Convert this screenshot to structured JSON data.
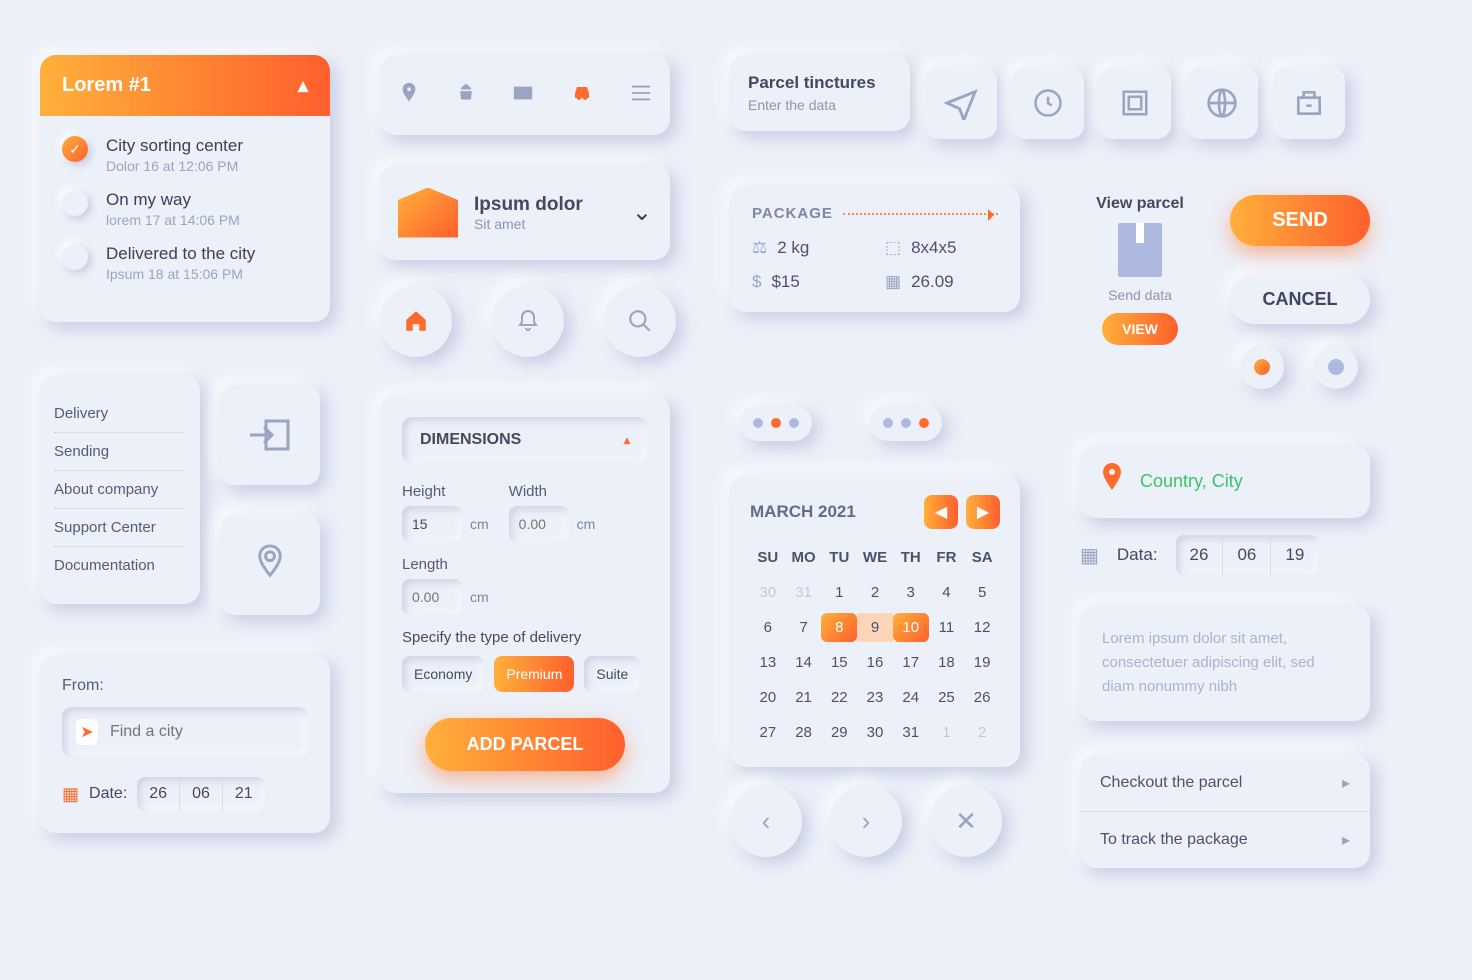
{
  "tracking": {
    "title": "Lorem #1",
    "steps": [
      {
        "title": "City sorting center",
        "sub": "Dolor 16 at 12:06 PM",
        "done": true
      },
      {
        "title": "On my way",
        "sub": "lorem 17 at 14:06 PM",
        "done": false
      },
      {
        "title": "Delivered to the city",
        "sub": "Ipsum 18 at 15:06 PM",
        "done": false
      }
    ]
  },
  "ipsum": {
    "title": "Ipsum dolor",
    "sub": "Sit amet"
  },
  "menu": [
    "Delivery",
    "Sending",
    "About company",
    "Support Center",
    "Documentation"
  ],
  "from": {
    "label": "From:",
    "placeholder": "Find a city",
    "date_label": "Date:",
    "date": [
      "26",
      "06",
      "21"
    ]
  },
  "dimensions": {
    "heading": "DIMENSIONS",
    "height_label": "Height",
    "height_val": "15",
    "width_label": "Width",
    "width_ph": "0.00",
    "length_label": "Length",
    "length_ph": "0.00",
    "unit": "cm",
    "specify": "Specify the type of delivery",
    "types": [
      "Economy",
      "Premium",
      "Suite"
    ],
    "add": "ADD PARCEL"
  },
  "pt": {
    "title": "Parcel tinctures",
    "sub": "Enter the data"
  },
  "package": {
    "heading": "PACKAGE",
    "weight": "2 kg",
    "dims": "8x4x5",
    "price": "$15",
    "date": "26.09"
  },
  "viewparcel": {
    "title": "View parcel",
    "sub": "Send data",
    "btn": "VIEW"
  },
  "send": "SEND",
  "cancel": "CANCEL",
  "calendar": {
    "title": "MARCH 2021",
    "dow": [
      "SU",
      "MO",
      "TU",
      "WE",
      "TH",
      "FR",
      "SA"
    ],
    "days": [
      {
        "n": "30",
        "m": true
      },
      {
        "n": "31",
        "m": true
      },
      {
        "n": "1"
      },
      {
        "n": "2"
      },
      {
        "n": "3"
      },
      {
        "n": "4"
      },
      {
        "n": "5"
      },
      {
        "n": "6"
      },
      {
        "n": "7"
      },
      {
        "n": "8",
        "s": true
      },
      {
        "n": "9",
        "r": true
      },
      {
        "n": "10",
        "s": true
      },
      {
        "n": "11"
      },
      {
        "n": "12"
      },
      {
        "n": "13"
      },
      {
        "n": "14"
      },
      {
        "n": "15"
      },
      {
        "n": "16"
      },
      {
        "n": "17"
      },
      {
        "n": "18"
      },
      {
        "n": "19"
      },
      {
        "n": "20"
      },
      {
        "n": "21"
      },
      {
        "n": "22"
      },
      {
        "n": "23"
      },
      {
        "n": "24"
      },
      {
        "n": "25"
      },
      {
        "n": "26"
      },
      {
        "n": "27"
      },
      {
        "n": "28"
      },
      {
        "n": "29"
      },
      {
        "n": "30"
      },
      {
        "n": "31"
      },
      {
        "n": "1",
        "m": true
      },
      {
        "n": "2",
        "m": true
      }
    ]
  },
  "location": "Country, City",
  "data": {
    "label": "Data:",
    "vals": [
      "26",
      "06",
      "19"
    ]
  },
  "lorem": "Lorem ipsum dolor sit amet, consectetuer adipiscing elit, sed diam nonummy nibh",
  "ctas": [
    "Checkout the parcel",
    "To track the package"
  ]
}
